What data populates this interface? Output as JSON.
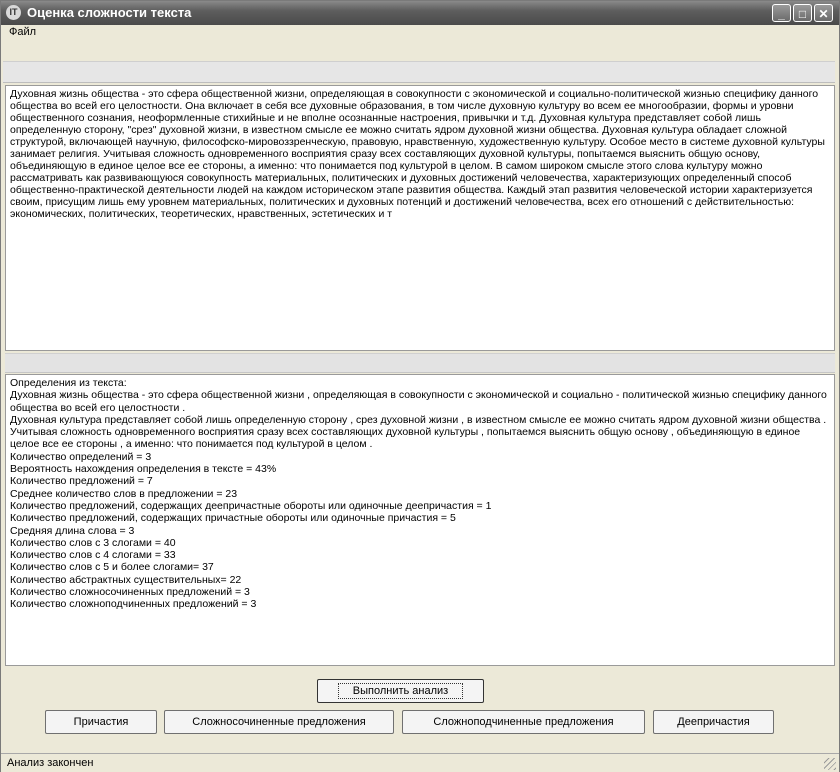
{
  "window": {
    "title": "Оценка сложности текста",
    "icon": "app-icon",
    "controls": {
      "minimize": "_",
      "maximize": "□",
      "close": "✕"
    }
  },
  "menu": {
    "file": "Файл"
  },
  "source_text": "Духовная жизнь общества - это сфера общественной жизни, определяющая в совокупности с экономической и социально-политической жизнью спецификy данного общества во всей его целостности. Она включает в себя все духовные образования, в том числе духовную культуру во всем ее многообразии, формы и уровни общественного сознания, неоформленные стихийные и не вполне осознанные настроения, привычки и т.д. Духовная культура представляет собой лишь определенную сторону, \"срез\" духовной жизни, в известном смысле ее можно считать ядром духовной жизни общества. Духовная культура обладает сложной структурой, включающей научную, философско-мировоззренческую, правовую, нравственную, художественную культуру. Особое место в системе духовной культуры занимает религия. Учитывая сложность одновременного восприятия сразу всех составляющих духовной культуры, попытаемся выяснить общую основу, объединяющую в единое целое все ее стороны, а именно: что понимается под культурой в целом. В самом широком смысле этого слова культуру можно рассматривать как развивающуюся совокупность материальных, политических и духовных достижений человечества, характеризующих определенный способ общественно-практической деятельности людей на каждом историческом этапе развития общества. Каждый этап развития человеческой истории характеризуется своим, присущим лишь ему уровнем материальных, политических и духовных потенций и достижений человечества, всех его отношений с действительностью: экономических, политических, теоретических, нравственных, эстетических и т",
  "result_text": "Определения из текста:\nДуховная жизнь общества - это сфера общественной жизни , определяющая в совокупности с экономической и социально - политической жизнью спецификy данного общества во всей его целостности .\nДуховная культура представляет собой лишь определенную сторону , срез духовной жизни , в известном смысле ее можно считать ядром духовной жизни общества .\nУчитывая сложность одновременного восприятия сразу всех составляющих духовной культуры , попытаемся выяснить общую основу , объединяющую в единое целое все ее стороны , а именно: что понимается под культурой в целом .\nКоличество определений = 3\nВероятность нахождения определения в тексте = 43%\nКоличество предложений = 7\nСреднее количество слов в предложении = 23\nКоличество предложений, содержащих деепричастные обороты или одиночные деепричастия = 1\nКоличество предложений, содержащих причастные обороты или одиночные причастия = 5\nСредняя длина слова = 3\nКоличество слов с 3 слогами = 40\nКоличество слов с 4 слогами = 33\nКоличество слов с 5 и более слогами= 37\nКоличество абстрактных существительных= 22\nКоличество сложносочиненных предложений = 3\nКоличество сложноподчиненных предложений = 3",
  "buttons": {
    "analyze": "Выполнить анализ",
    "participles": "Причастия",
    "compound": "Сложносочиненные предложения",
    "complex": "Сложноподчиненные предложения",
    "gerunds": "Деепричастия"
  },
  "status": "Анализ закончен"
}
